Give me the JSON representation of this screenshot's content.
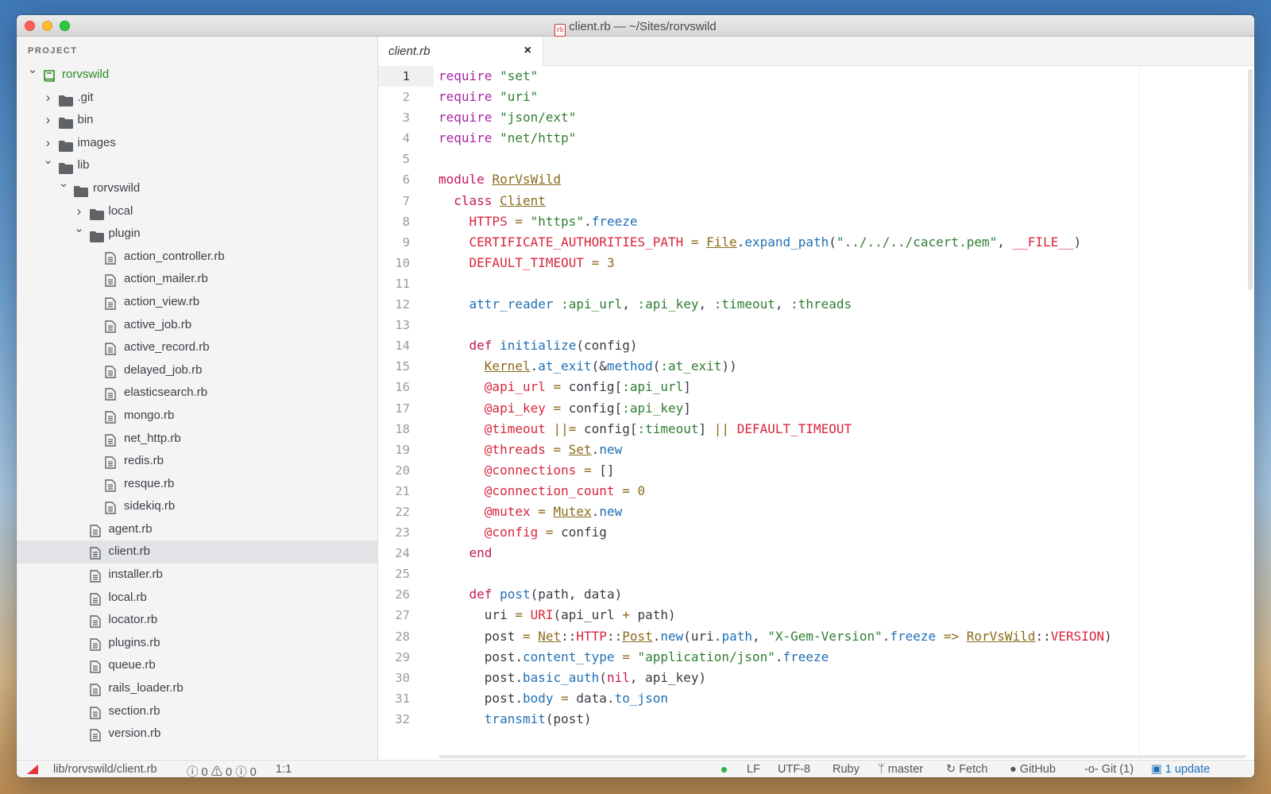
{
  "window": {
    "title": "client.rb — ~/Sites/rorvswild"
  },
  "sidebar": {
    "header": "PROJECT",
    "tree": [
      {
        "label": "rorvswild",
        "type": "root",
        "depth": 0,
        "expanded": true
      },
      {
        "label": ".git",
        "type": "folder",
        "depth": 1,
        "expanded": false
      },
      {
        "label": "bin",
        "type": "folder",
        "depth": 1,
        "expanded": false
      },
      {
        "label": "images",
        "type": "folder",
        "depth": 1,
        "expanded": false
      },
      {
        "label": "lib",
        "type": "folder",
        "depth": 1,
        "expanded": true
      },
      {
        "label": "rorvswild",
        "type": "folder",
        "depth": 2,
        "expanded": true
      },
      {
        "label": "local",
        "type": "folder",
        "depth": 3,
        "expanded": false
      },
      {
        "label": "plugin",
        "type": "folder",
        "depth": 3,
        "expanded": true
      },
      {
        "label": "action_controller.rb",
        "type": "file",
        "depth": 4
      },
      {
        "label": "action_mailer.rb",
        "type": "file",
        "depth": 4
      },
      {
        "label": "action_view.rb",
        "type": "file",
        "depth": 4
      },
      {
        "label": "active_job.rb",
        "type": "file",
        "depth": 4
      },
      {
        "label": "active_record.rb",
        "type": "file",
        "depth": 4
      },
      {
        "label": "delayed_job.rb",
        "type": "file",
        "depth": 4
      },
      {
        "label": "elasticsearch.rb",
        "type": "file",
        "depth": 4
      },
      {
        "label": "mongo.rb",
        "type": "file",
        "depth": 4
      },
      {
        "label": "net_http.rb",
        "type": "file",
        "depth": 4
      },
      {
        "label": "redis.rb",
        "type": "file",
        "depth": 4
      },
      {
        "label": "resque.rb",
        "type": "file",
        "depth": 4
      },
      {
        "label": "sidekiq.rb",
        "type": "file",
        "depth": 4
      },
      {
        "label": "agent.rb",
        "type": "file",
        "depth": 3
      },
      {
        "label": "client.rb",
        "type": "file",
        "depth": 3,
        "selected": true
      },
      {
        "label": "installer.rb",
        "type": "file",
        "depth": 3
      },
      {
        "label": "local.rb",
        "type": "file",
        "depth": 3
      },
      {
        "label": "locator.rb",
        "type": "file",
        "depth": 3
      },
      {
        "label": "plugins.rb",
        "type": "file",
        "depth": 3
      },
      {
        "label": "queue.rb",
        "type": "file",
        "depth": 3
      },
      {
        "label": "rails_loader.rb",
        "type": "file",
        "depth": 3
      },
      {
        "label": "section.rb",
        "type": "file",
        "depth": 3
      },
      {
        "label": "version.rb",
        "type": "file",
        "depth": 3
      }
    ]
  },
  "tabs": [
    {
      "label": "client.rb",
      "close": "×"
    }
  ],
  "editor": {
    "active_line": 1,
    "lines": [
      [
        [
          "k",
          "require"
        ],
        [
          "p",
          " "
        ],
        [
          "s",
          "\"set\""
        ]
      ],
      [
        [
          "k",
          "require"
        ],
        [
          "p",
          " "
        ],
        [
          "s",
          "\"uri\""
        ]
      ],
      [
        [
          "k",
          "require"
        ],
        [
          "p",
          " "
        ],
        [
          "s",
          "\"json/ext\""
        ]
      ],
      [
        [
          "k",
          "require"
        ],
        [
          "p",
          " "
        ],
        [
          "s",
          "\"net/http\""
        ]
      ],
      [],
      [
        [
          "kw",
          "module"
        ],
        [
          "p",
          " "
        ],
        [
          "cls",
          "RorVsWild"
        ]
      ],
      [
        [
          "p",
          "  "
        ],
        [
          "kw",
          "class"
        ],
        [
          "p",
          " "
        ],
        [
          "cls",
          "Client"
        ]
      ],
      [
        [
          "p",
          "    "
        ],
        [
          "c",
          "HTTPS"
        ],
        [
          "op",
          " = "
        ],
        [
          "s",
          "\"https\""
        ],
        [
          "p",
          "."
        ],
        [
          "m",
          "freeze"
        ]
      ],
      [
        [
          "p",
          "    "
        ],
        [
          "c",
          "CERTIFICATE_AUTHORITIES_PATH"
        ],
        [
          "op",
          " = "
        ],
        [
          "cls",
          "File"
        ],
        [
          "p",
          "."
        ],
        [
          "m",
          "expand_path"
        ],
        [
          "p",
          "("
        ],
        [
          "s",
          "\"../../../cacert.pem\""
        ],
        [
          "p",
          ", "
        ],
        [
          "c",
          "__FILE__"
        ],
        [
          "p",
          ")"
        ]
      ],
      [
        [
          "p",
          "    "
        ],
        [
          "c",
          "DEFAULT_TIMEOUT"
        ],
        [
          "op",
          " = "
        ],
        [
          "n",
          "3"
        ]
      ],
      [],
      [
        [
          "p",
          "    "
        ],
        [
          "m",
          "attr_reader"
        ],
        [
          "p",
          " "
        ],
        [
          "sym",
          ":api_url"
        ],
        [
          "p",
          ", "
        ],
        [
          "sym",
          ":api_key"
        ],
        [
          "p",
          ", "
        ],
        [
          "sym",
          ":timeout"
        ],
        [
          "p",
          ", "
        ],
        [
          "sym",
          ":threads"
        ]
      ],
      [],
      [
        [
          "p",
          "    "
        ],
        [
          "kw",
          "def"
        ],
        [
          "p",
          " "
        ],
        [
          "m",
          "initialize"
        ],
        [
          "p",
          "(config)"
        ]
      ],
      [
        [
          "p",
          "      "
        ],
        [
          "cls",
          "Kernel"
        ],
        [
          "p",
          "."
        ],
        [
          "m",
          "at_exit"
        ],
        [
          "p",
          "(&"
        ],
        [
          "m",
          "method"
        ],
        [
          "p",
          "("
        ],
        [
          "sym",
          ":at_exit"
        ],
        [
          "p",
          "))"
        ]
      ],
      [
        [
          "p",
          "      "
        ],
        [
          "iv",
          "@api_url"
        ],
        [
          "op",
          " = "
        ],
        [
          "p",
          "config["
        ],
        [
          "sym",
          ":api_url"
        ],
        [
          "p",
          "]"
        ]
      ],
      [
        [
          "p",
          "      "
        ],
        [
          "iv",
          "@api_key"
        ],
        [
          "op",
          " = "
        ],
        [
          "p",
          "config["
        ],
        [
          "sym",
          ":api_key"
        ],
        [
          "p",
          "]"
        ]
      ],
      [
        [
          "p",
          "      "
        ],
        [
          "iv",
          "@timeout"
        ],
        [
          "op",
          " ||= "
        ],
        [
          "p",
          "config["
        ],
        [
          "sym",
          ":timeout"
        ],
        [
          "p",
          "] "
        ],
        [
          "op",
          "||"
        ],
        [
          "p",
          " "
        ],
        [
          "c",
          "DEFAULT_TIMEOUT"
        ]
      ],
      [
        [
          "p",
          "      "
        ],
        [
          "iv",
          "@threads"
        ],
        [
          "op",
          " = "
        ],
        [
          "cls",
          "Set"
        ],
        [
          "p",
          "."
        ],
        [
          "m",
          "new"
        ]
      ],
      [
        [
          "p",
          "      "
        ],
        [
          "iv",
          "@connections"
        ],
        [
          "op",
          " = "
        ],
        [
          "p",
          "[]"
        ]
      ],
      [
        [
          "p",
          "      "
        ],
        [
          "iv",
          "@connection_count"
        ],
        [
          "op",
          " = "
        ],
        [
          "n",
          "0"
        ]
      ],
      [
        [
          "p",
          "      "
        ],
        [
          "iv",
          "@mutex"
        ],
        [
          "op",
          " = "
        ],
        [
          "cls",
          "Mutex"
        ],
        [
          "p",
          "."
        ],
        [
          "m",
          "new"
        ]
      ],
      [
        [
          "p",
          "      "
        ],
        [
          "iv",
          "@config"
        ],
        [
          "op",
          " = "
        ],
        [
          "p",
          "config"
        ]
      ],
      [
        [
          "p",
          "    "
        ],
        [
          "kw",
          "end"
        ]
      ],
      [],
      [
        [
          "p",
          "    "
        ],
        [
          "kw",
          "def"
        ],
        [
          "p",
          " "
        ],
        [
          "m",
          "post"
        ],
        [
          "p",
          "(path, data)"
        ]
      ],
      [
        [
          "p",
          "      uri"
        ],
        [
          "op",
          " = "
        ],
        [
          "c",
          "URI"
        ],
        [
          "p",
          "(api_url "
        ],
        [
          "op",
          "+"
        ],
        [
          "p",
          " path)"
        ]
      ],
      [
        [
          "p",
          "      post"
        ],
        [
          "op",
          " = "
        ],
        [
          "cls",
          "Net"
        ],
        [
          "p",
          "::"
        ],
        [
          "c",
          "HTTP"
        ],
        [
          "p",
          "::"
        ],
        [
          "cls",
          "Post"
        ],
        [
          "p",
          "."
        ],
        [
          "m",
          "new"
        ],
        [
          "p",
          "(uri."
        ],
        [
          "m",
          "path"
        ],
        [
          "p",
          ", "
        ],
        [
          "s",
          "\"X-Gem-Version\""
        ],
        [
          "p",
          "."
        ],
        [
          "m",
          "freeze"
        ],
        [
          "p",
          " "
        ],
        [
          "op",
          "=>"
        ],
        [
          "p",
          " "
        ],
        [
          "cls",
          "RorVsWild"
        ],
        [
          "p",
          "::"
        ],
        [
          "c",
          "VERSION"
        ],
        [
          "p",
          ")"
        ]
      ],
      [
        [
          "p",
          "      post."
        ],
        [
          "m",
          "content_type"
        ],
        [
          "op",
          " = "
        ],
        [
          "s",
          "\"application/json\""
        ],
        [
          "p",
          "."
        ],
        [
          "m",
          "freeze"
        ]
      ],
      [
        [
          "p",
          "      post."
        ],
        [
          "m",
          "basic_auth"
        ],
        [
          "p",
          "("
        ],
        [
          "kw",
          "nil"
        ],
        [
          "p",
          ", api_key)"
        ]
      ],
      [
        [
          "p",
          "      post."
        ],
        [
          "m",
          "body"
        ],
        [
          "op",
          " = "
        ],
        [
          "p",
          "data."
        ],
        [
          "m",
          "to_json"
        ]
      ],
      [
        [
          "p",
          "      "
        ],
        [
          "m",
          "transmit"
        ],
        [
          "p",
          "(post)"
        ]
      ]
    ]
  },
  "statusbar": {
    "path": "lib/rorvswild/client.rb",
    "diagnostics": "ⓘ 0 ⚠ 0 ⓘ 0",
    "cursor": "1:1",
    "line_ending": "LF",
    "encoding": "UTF-8",
    "grammar": "Ruby",
    "branch": "master",
    "fetch": "Fetch",
    "github": "GitHub",
    "git": "Git (1)",
    "update": "1 update"
  }
}
